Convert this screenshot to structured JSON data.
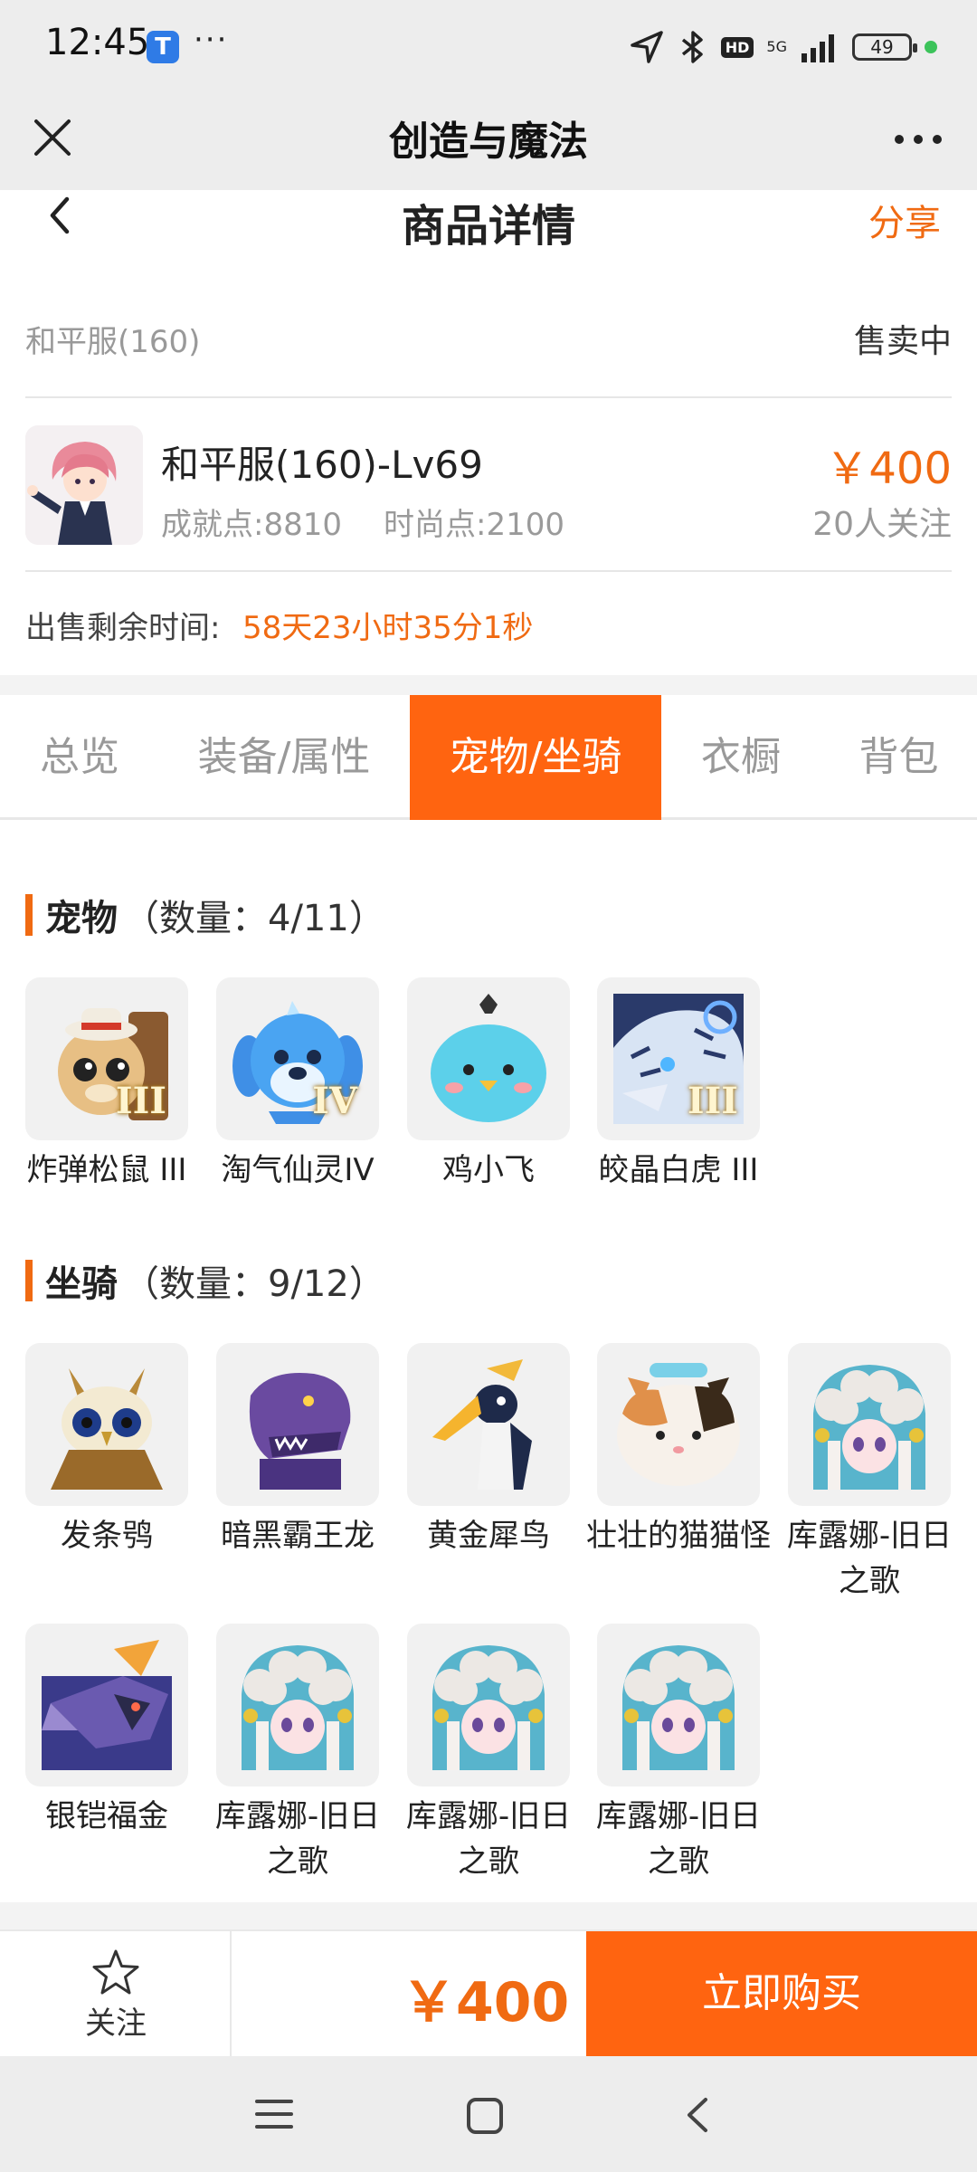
{
  "status_bar": {
    "time": "12:45",
    "app_icon_letter": "T",
    "more_dots": "···",
    "hd": "HD",
    "network": "5G",
    "battery": "49"
  },
  "title_bar": {
    "title": "创造与魔法"
  },
  "header": {
    "page_title": "商品详情",
    "share": "分享"
  },
  "listing": {
    "server": "和平服(160)",
    "sale_status": "售卖中",
    "name": "和平服(160)-Lv69",
    "achievement": "成就点:8810",
    "fashion": "时尚点:2100",
    "price": "￥400",
    "followers": "20人关注",
    "remain_label": "出售剩余时间:",
    "remain_value": "58天23小时35分1秒"
  },
  "tabs": [
    {
      "label": "总览",
      "active": false
    },
    {
      "label": "装备/属性",
      "active": false
    },
    {
      "label": "宠物/坐骑",
      "active": true
    },
    {
      "label": "衣橱",
      "active": false
    },
    {
      "label": "背包",
      "active": false
    }
  ],
  "pets": {
    "title": "宠物",
    "count": "（数量：4/11）",
    "items": [
      {
        "name": "炸弹松鼠 III",
        "rank": "III",
        "icon": "squirrel-icon"
      },
      {
        "name": "淘气仙灵IV",
        "rank": "IV",
        "icon": "blue-pup-icon"
      },
      {
        "name": "鸡小飞",
        "rank": "",
        "icon": "chick-icon"
      },
      {
        "name": "皎晶白虎 III",
        "rank": "III",
        "icon": "white-tiger-icon"
      }
    ]
  },
  "mounts": {
    "title": "坐骑",
    "count": "（数量：9/12）",
    "items": [
      {
        "name": "发条鸮",
        "icon": "owl-icon"
      },
      {
        "name": "暗黑霸王龙",
        "icon": "dark-trex-icon"
      },
      {
        "name": "黄金犀鸟",
        "icon": "hornbill-icon"
      },
      {
        "name": "壮壮的猫猫怪",
        "icon": "cat-monster-icon"
      },
      {
        "name": "库露娜-旧日之歌",
        "icon": "kuluna-icon"
      },
      {
        "name": "银铠福金",
        "icon": "silver-dragon-icon"
      },
      {
        "name": "库露娜-旧日之歌",
        "icon": "kuluna-icon"
      },
      {
        "name": "库露娜-旧日之歌",
        "icon": "kuluna-icon"
      },
      {
        "name": "库露娜-旧日之歌",
        "icon": "kuluna-icon"
      }
    ]
  },
  "bottom_bar": {
    "follow": "关注",
    "price": "￥400",
    "buy": "立即购买"
  },
  "colors": {
    "accent": "#ff6410",
    "price": "#f06a12"
  }
}
